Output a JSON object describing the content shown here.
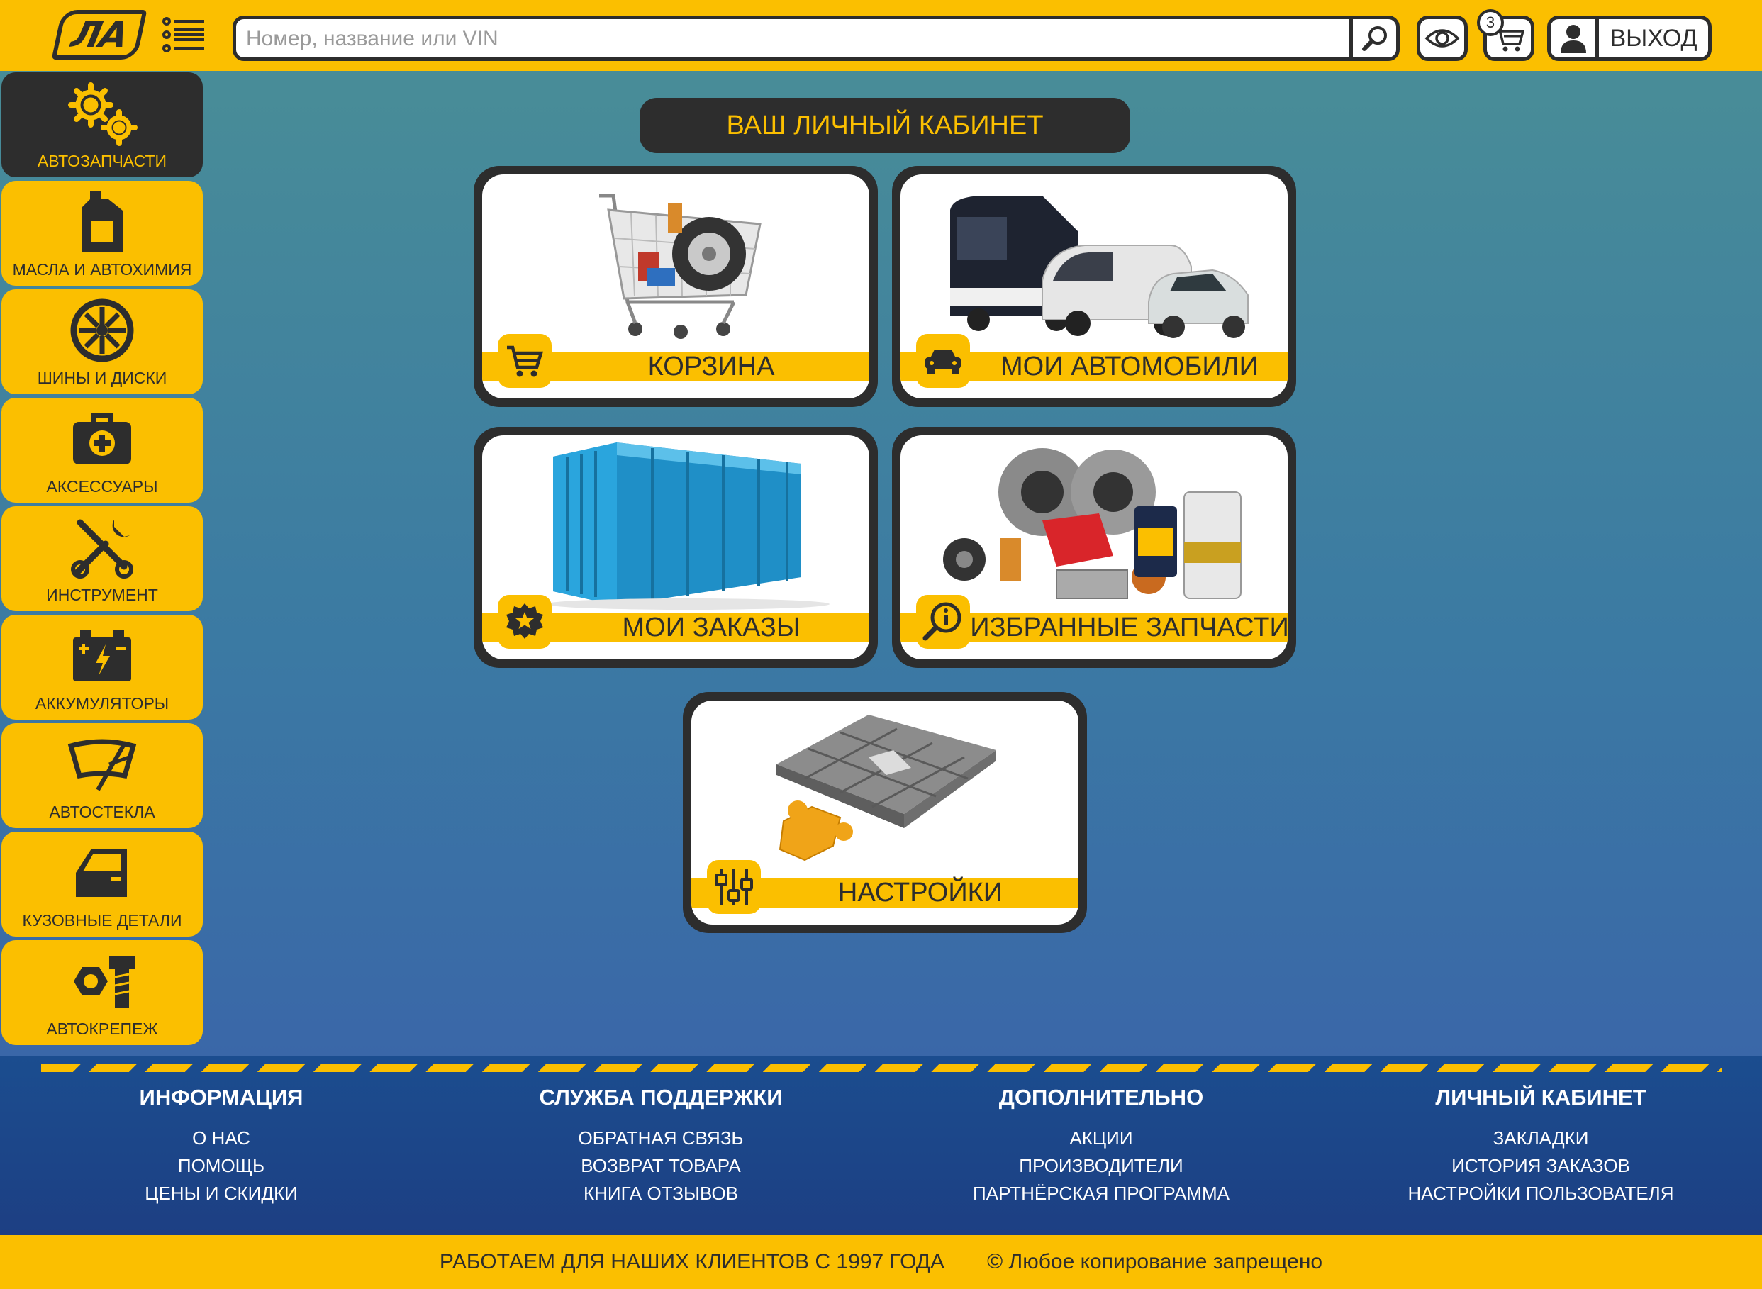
{
  "header": {
    "logo_text": "ЛА",
    "search_placeholder": "Номер, название или VIN",
    "cart_count": "3",
    "logout_label": "ВЫХОД"
  },
  "sidebar": {
    "items": [
      {
        "label": "АВТОЗАПЧАСТИ",
        "icon": "gears-icon",
        "active": true
      },
      {
        "label": "МАСЛА И АВТОХИМИЯ",
        "icon": "oil-canister-icon"
      },
      {
        "label": "ШИНЫ И ДИСКИ",
        "icon": "wheel-icon"
      },
      {
        "label": "АКСЕССУАРЫ",
        "icon": "first-aid-kit-icon"
      },
      {
        "label": "ИНСТРУМЕНТ",
        "icon": "tools-icon"
      },
      {
        "label": "АККУМУЛЯТОРЫ",
        "icon": "battery-icon"
      },
      {
        "label": "АВТОСТЕКЛА",
        "icon": "windshield-icon"
      },
      {
        "label": "КУЗОВНЫЕ ДЕТАЛИ",
        "icon": "car-door-icon"
      },
      {
        "label": "АВТОКРЕПЕЖ",
        "icon": "bolt-nut-icon"
      }
    ]
  },
  "main": {
    "title": "ВАШ ЛИЧНЫЙ КАБИНЕТ",
    "cards": [
      {
        "label": "КОРЗИНА",
        "icon": "cart-icon"
      },
      {
        "label": "МОИ АВТОМОБИЛИ",
        "icon": "car-icon"
      },
      {
        "label": "МОИ ЗАКАЗЫ",
        "icon": "badge-star-icon"
      },
      {
        "label": "ИЗБРАННЫЕ ЗАПЧАСТИ",
        "icon": "search-info-icon"
      },
      {
        "label": "НАСТРОЙКИ",
        "icon": "sliders-icon"
      }
    ]
  },
  "footer": {
    "columns": [
      {
        "heading": "ИНФОРМАЦИЯ",
        "links": [
          "О НАС",
          "ПОМОЩЬ",
          "ЦЕНЫ И СКИДКИ"
        ]
      },
      {
        "heading": "СЛУЖБА ПОДДЕРЖКИ",
        "links": [
          "ОБРАТНАЯ СВЯЗЬ",
          "ВОЗВРАТ ТОВАРА",
          "КНИГА ОТЗЫВОВ"
        ]
      },
      {
        "heading": "ДОПОЛНИТЕЛЬНО",
        "links": [
          "АКЦИИ",
          "ПРОИЗВОДИТЕЛИ",
          "ПАРТНЁРСКАЯ ПРОГРАММА"
        ]
      },
      {
        "heading": "ЛИЧНЫЙ КАБИНЕТ",
        "links": [
          "ЗАКЛАДКИ",
          "ИСТОРИЯ ЗАКАЗОВ",
          "НАСТРОЙКИ ПОЛЬЗОВАТЕЛЯ"
        ]
      }
    ],
    "slogan": "РАБОТАЕМ ДЛЯ НАШИХ КЛИЕНТОВ С 1997 ГОДА",
    "copyright": "©  Любое копирование запрещено"
  },
  "colors": {
    "accent": "#fbbf00",
    "dark": "#2d2d2d",
    "footer": "#1b4d8f"
  }
}
